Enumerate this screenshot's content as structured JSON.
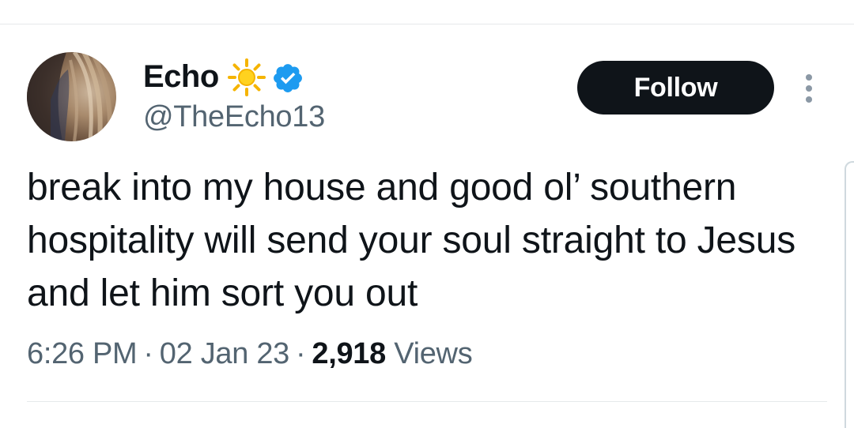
{
  "author": {
    "display_name": "Echo",
    "handle": "@TheEcho13",
    "emoji_icon": "sun-icon",
    "verified_icon": "verified-badge-icon",
    "verified_color": "#1d9bf0"
  },
  "actions": {
    "follow_label": "Follow",
    "more_icon": "more-vertical-icon"
  },
  "tweet": {
    "text": "break into my house and good ol’ southern hospitality will send your soul straight to Jesus and let him sort you out"
  },
  "meta": {
    "time": "6:26 PM",
    "separator": "·",
    "date": "02 Jan 23",
    "views_count": "2,918",
    "views_label": "Views"
  },
  "colors": {
    "text_primary": "#0f1419",
    "text_secondary": "#536471",
    "follow_bg": "#0f1419",
    "sun_yellow": "#f5b400"
  }
}
